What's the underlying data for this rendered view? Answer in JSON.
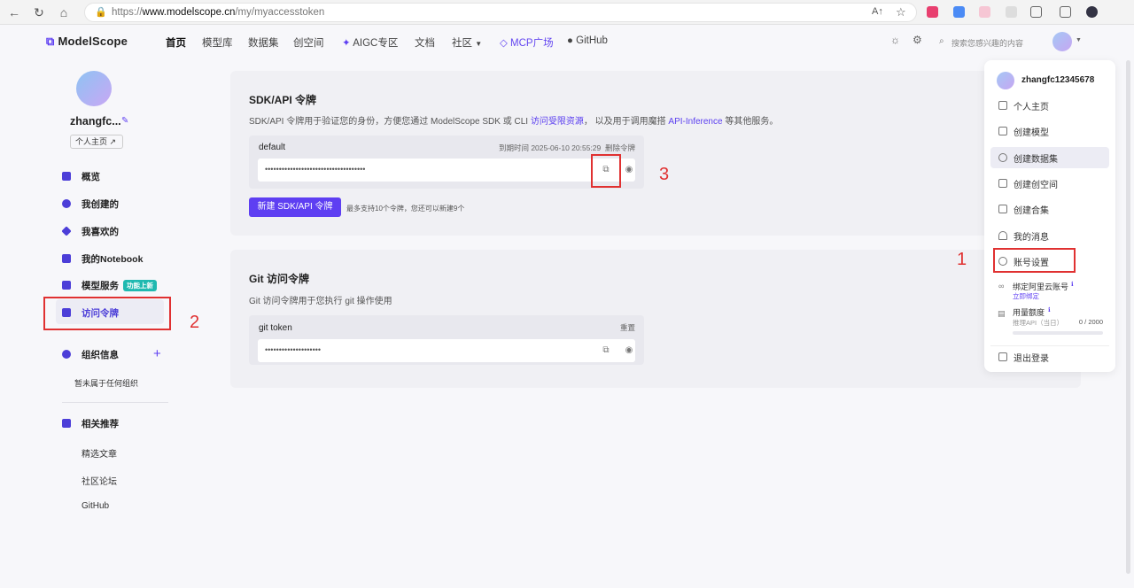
{
  "browser": {
    "url_scheme": "https://",
    "url_host": "www.modelscope.cn",
    "url_path": "/my/myaccesstoken"
  },
  "header": {
    "logo": "ModelScope",
    "nav": [
      "首页",
      "模型库",
      "数据集",
      "创空间",
      "AIGC专区",
      "文档",
      "社区",
      "MCP广场",
      "GitHub"
    ],
    "search_placeholder": "搜索您感兴趣的内容"
  },
  "sidebar": {
    "username": "zhangfc...",
    "profile_button": "个人主页",
    "items": [
      "概览",
      "我创建的",
      "我喜欢的",
      "我的Notebook",
      "模型服务",
      "访问令牌"
    ],
    "new_tag": "功能上新",
    "org_title": "组织信息",
    "org_empty": "暂未属于任何组织",
    "rec_title": "相关推荐",
    "rec_items": [
      "精选文章",
      "社区论坛",
      "GitHub"
    ]
  },
  "sdk_card": {
    "title": "SDK/API 令牌",
    "desc_pre": "SDK/API 令牌用于验证您的身份，方便您通过 ModelScope SDK 或 CLI ",
    "desc_link1": "访问受限资源",
    "desc_mid": "，  以及用于调用魔搭 ",
    "desc_link2": "API-Inference",
    "desc_post": " 等其他服务。",
    "token_name": "default",
    "expire": "到期时间 2025-06-10 20:55:29",
    "delete": "删除令牌",
    "token_mask": "••••••••••••••••••••••••••••••••••••",
    "new_button": "新建 SDK/API 令牌",
    "limit_note": "最多支持10个令牌，您还可以新建9个"
  },
  "git_card": {
    "title": "Git 访问令牌",
    "desc": "Git 访问令牌用于您执行 git 操作使用",
    "token_name": "git token",
    "reset": "重置",
    "token_mask": "••••••••••••••••••••"
  },
  "dropdown": {
    "username": "zhangfc12345678",
    "items": [
      "个人主页",
      "创建模型",
      "创建数据集",
      "创建创空间",
      "创建合集",
      "我的消息",
      "账号设置"
    ],
    "bind_label": "绑定阿里云账号",
    "bind_action": "立即绑定",
    "quota_label": "用量额度",
    "quota_sub": "推理API（当日）",
    "quota_value": "0 / 2000",
    "logout": "退出登录"
  },
  "annotations": [
    "1",
    "2",
    "3"
  ],
  "colors": {
    "accent": "#5e3ff2",
    "annotation": "#e03131",
    "tag": "#1fb9b0"
  }
}
